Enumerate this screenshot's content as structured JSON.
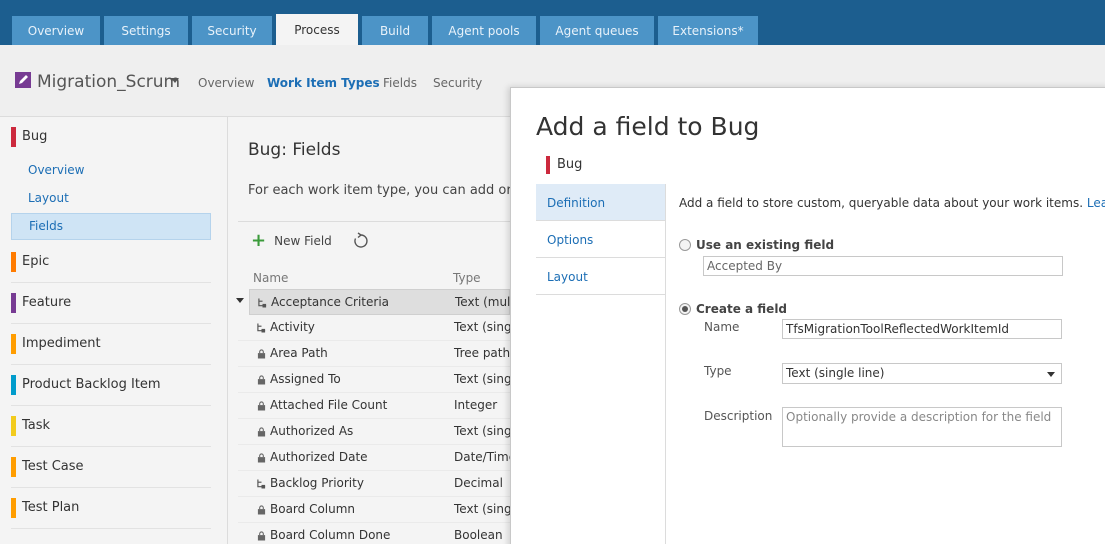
{
  "top_tabs": [
    "Overview",
    "Settings",
    "Security",
    "Process",
    "Build",
    "Agent pools",
    "Agent queues",
    "Extensions*"
  ],
  "project": {
    "name": "Migration_Scrum"
  },
  "hubs": [
    "Overview",
    "Work Item Types",
    "Fields",
    "Security"
  ],
  "sidebar": {
    "work_item_types": [
      {
        "label": "Bug",
        "color": "#cc293d"
      },
      {
        "label": "Epic",
        "color": "#ff7b00"
      },
      {
        "label": "Feature",
        "color": "#773b93"
      },
      {
        "label": "Impediment",
        "color": "#ff9d00"
      },
      {
        "label": "Product Backlog Item",
        "color": "#009ccc"
      },
      {
        "label": "Task",
        "color": "#f2cb1d"
      },
      {
        "label": "Test Case",
        "color": "#ff9d00"
      },
      {
        "label": "Test Plan",
        "color": "#ff9d00"
      }
    ],
    "bug_subitems": [
      "Overview",
      "Layout",
      "Fields"
    ]
  },
  "content": {
    "title": "Bug: Fields",
    "description": "For each work item type, you can add or m",
    "new_field_label": "New Field",
    "columns": {
      "name": "Name",
      "type": "Type"
    },
    "rows": [
      {
        "name": "Acceptance Criteria",
        "type": "Text (multi",
        "icon": "inherited-icon"
      },
      {
        "name": "Activity",
        "type": "Text (single",
        "icon": "inherited-icon"
      },
      {
        "name": "Area Path",
        "type": "Tree path",
        "icon": "lock-icon"
      },
      {
        "name": "Assigned To",
        "type": "Text (single",
        "icon": "lock-icon"
      },
      {
        "name": "Attached File Count",
        "type": "Integer",
        "icon": "lock-icon"
      },
      {
        "name": "Authorized As",
        "type": "Text (single",
        "icon": "lock-icon"
      },
      {
        "name": "Authorized Date",
        "type": "Date/Time",
        "icon": "lock-icon"
      },
      {
        "name": "Backlog Priority",
        "type": "Decimal",
        "icon": "inherited-icon"
      },
      {
        "name": "Board Column",
        "type": "Text (single",
        "icon": "lock-icon"
      },
      {
        "name": "Board Column Done",
        "type": "Boolean",
        "icon": "lock-icon"
      }
    ]
  },
  "dialog": {
    "title": "Add a field to Bug",
    "wit_label": "Bug",
    "nav": [
      "Definition",
      "Options",
      "Layout"
    ],
    "info_text": "Add a field to store custom, queryable data about your work items.",
    "learn_more": "Learn more",
    "existing_label": "Use an existing field",
    "existing_value": "Accepted By",
    "create_label": "Create a field",
    "name_label": "Name",
    "name_value": "TfsMigrationToolReflectedWorkItemId",
    "type_label": "Type",
    "type_value": "Text (single line)",
    "desc_label": "Description",
    "desc_placeholder": "Optionally provide a description for the field"
  }
}
